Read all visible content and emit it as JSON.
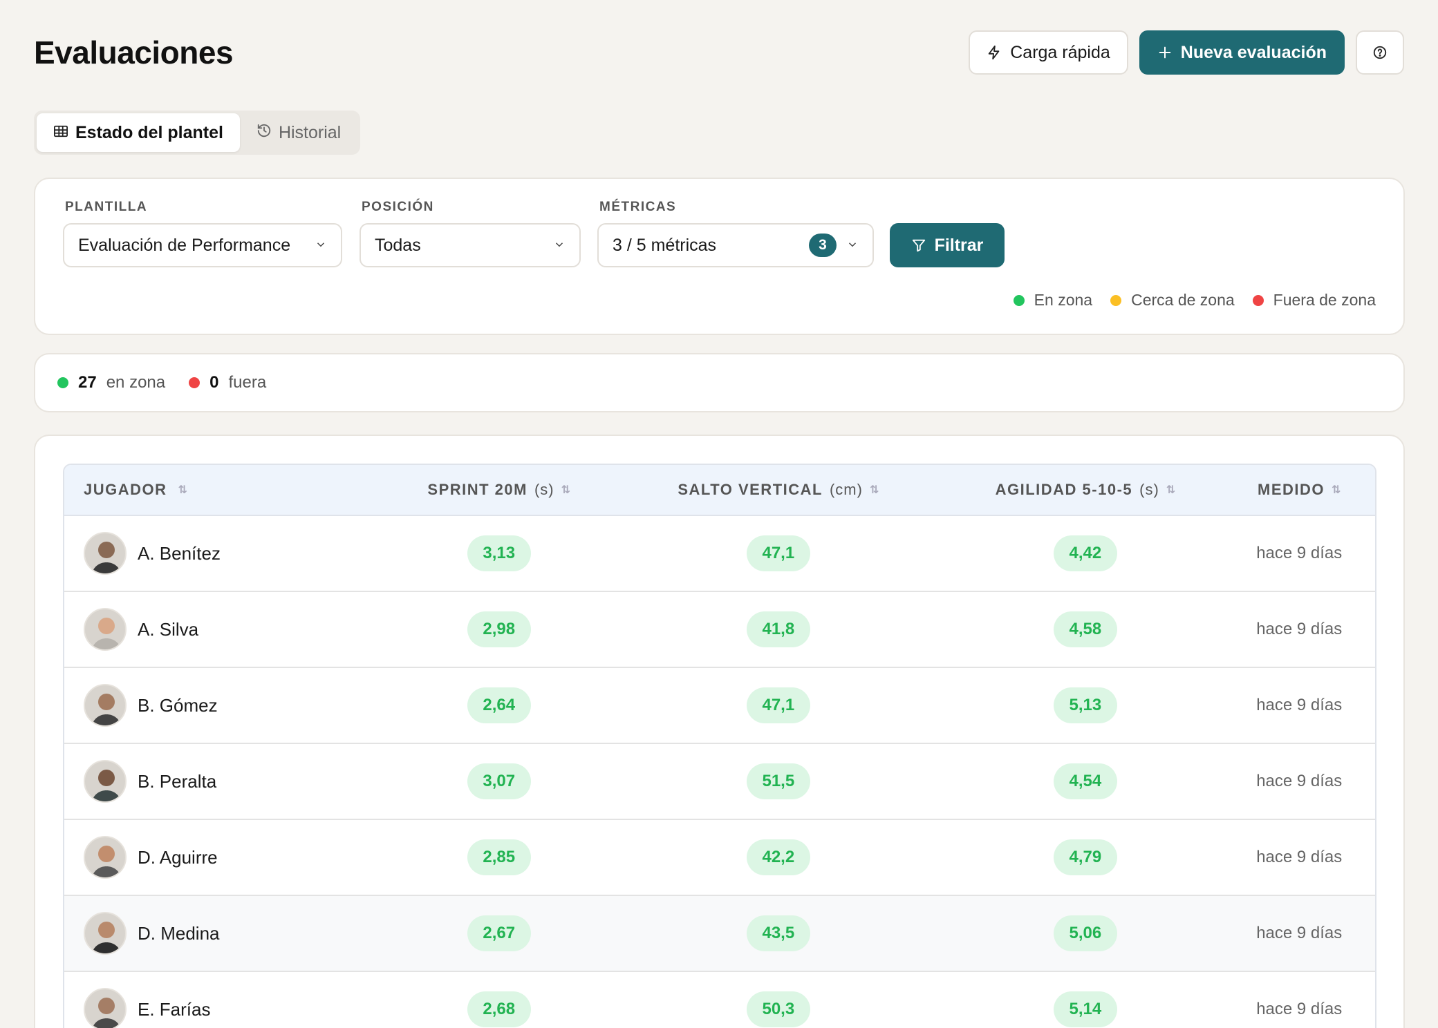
{
  "header": {
    "title": "Evaluaciones",
    "quick_load_label": "Carga rápida",
    "new_eval_label": "Nueva evaluación"
  },
  "tabs": [
    {
      "label": "Estado del plantel",
      "active": true
    },
    {
      "label": "Historial",
      "active": false
    }
  ],
  "filters": {
    "template": {
      "label": "PLANTILLA",
      "value": "Evaluación de Performance"
    },
    "position": {
      "label": "POSICIÓN",
      "value": "Todas"
    },
    "metrics": {
      "label": "MÉTRICAS",
      "value": "3 / 5 métricas",
      "count": "3"
    },
    "filter_button": "Filtrar"
  },
  "legend": [
    {
      "label": "En zona",
      "color": "#22c55e"
    },
    {
      "label": "Cerca de zona",
      "color": "#fbbf24"
    },
    {
      "label": "Fuera de zona",
      "color": "#ef4444"
    }
  ],
  "summary": {
    "in_zone_count": "27",
    "in_zone_label": "en zona",
    "out_count": "0",
    "out_label": "fuera"
  },
  "table": {
    "columns": [
      {
        "label": "JUGADOR",
        "unit": ""
      },
      {
        "label": "SPRINT 20M",
        "unit": "(s)"
      },
      {
        "label": "SALTO VERTICAL",
        "unit": "(cm)"
      },
      {
        "label": "AGILIDAD 5-10-5",
        "unit": "(s)"
      },
      {
        "label": "MEDIDO",
        "unit": ""
      }
    ],
    "rows": [
      {
        "name": "A. Benítez",
        "sprint": "3,13",
        "salto": "47,1",
        "agilidad": "4,42",
        "medido": "hace 9 días"
      },
      {
        "name": "A. Silva",
        "sprint": "2,98",
        "salto": "41,8",
        "agilidad": "4,58",
        "medido": "hace 9 días"
      },
      {
        "name": "B. Gómez",
        "sprint": "2,64",
        "salto": "47,1",
        "agilidad": "5,13",
        "medido": "hace 9 días"
      },
      {
        "name": "B. Peralta",
        "sprint": "3,07",
        "salto": "51,5",
        "agilidad": "4,54",
        "medido": "hace 9 días"
      },
      {
        "name": "D. Aguirre",
        "sprint": "2,85",
        "salto": "42,2",
        "agilidad": "4,79",
        "medido": "hace 9 días"
      },
      {
        "name": "D. Medina",
        "sprint": "2,67",
        "salto": "43,5",
        "agilidad": "5,06",
        "medido": "hace 9 días"
      },
      {
        "name": "E. Farías",
        "sprint": "2,68",
        "salto": "50,3",
        "agilidad": "5,14",
        "medido": "hace 9 días"
      }
    ]
  }
}
